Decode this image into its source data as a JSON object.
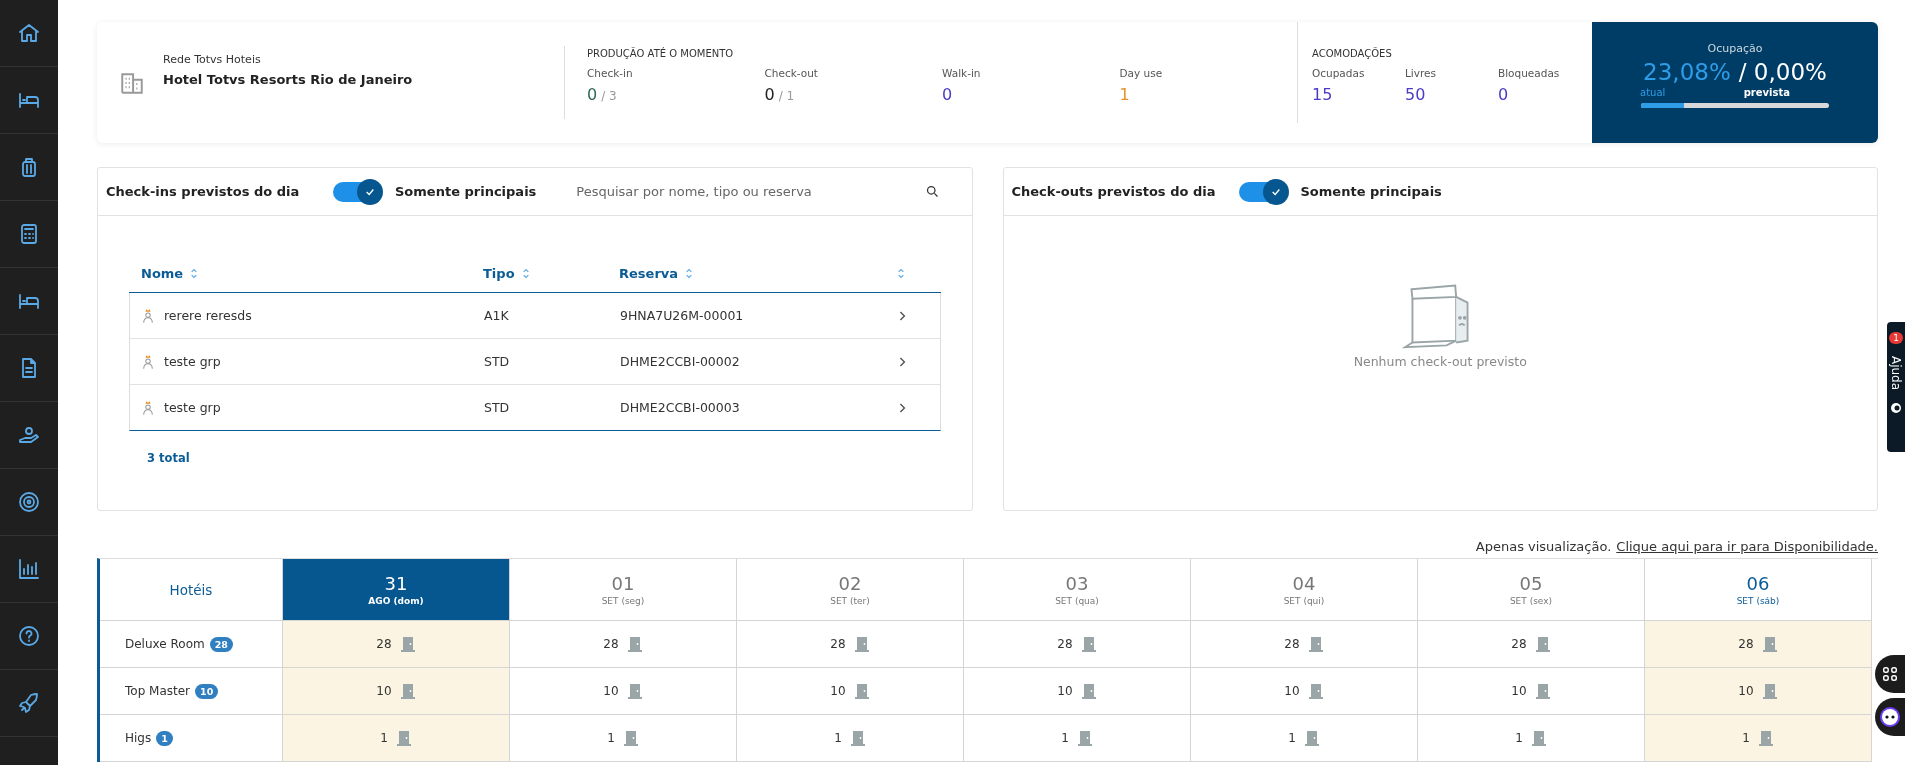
{
  "sidebar": {
    "items": [
      {
        "kind": "home"
      },
      {
        "kind": "bed"
      },
      {
        "kind": "luggage"
      },
      {
        "kind": "calculator"
      },
      {
        "kind": "bed"
      },
      {
        "kind": "document"
      },
      {
        "kind": "hand"
      },
      {
        "kind": "target"
      },
      {
        "kind": "chart"
      },
      {
        "kind": "help"
      },
      {
        "kind": "rocket"
      }
    ]
  },
  "header": {
    "network": "Rede Totvs Hoteis",
    "hotel": "Hotel Totvs Resorts Rio de Janeiro",
    "production": {
      "title": "PRODUÇÃO ATÉ O MOMENTO",
      "stats": [
        {
          "label": "Check-in",
          "value": "0",
          "total": "/ 3",
          "color": "#2d6a4f"
        },
        {
          "label": "Check-out",
          "value": "0",
          "total": "/ 1",
          "color": "#222222"
        },
        {
          "label": "Walk-in",
          "value": "0",
          "color": "#4b3cc4"
        },
        {
          "label": "Day use",
          "value": "1",
          "color": "#e8902a"
        }
      ]
    },
    "rooms": {
      "title": "ACOMODAÇÕES",
      "stats": [
        {
          "label": "Ocupadas",
          "value": "15",
          "color": "#4b3cc4"
        },
        {
          "label": "Livres",
          "value": "50",
          "color": "#4b3cc4"
        },
        {
          "label": "Bloqueadas",
          "value": "0",
          "color": "#4b3cc4"
        }
      ]
    },
    "occupancy": {
      "title": "Ocupação",
      "current": "23,08%",
      "forecast": "/ 0,00%",
      "current_label": "atual",
      "forecast_label": "prevista",
      "level": 0.23
    }
  },
  "checkins": {
    "title": "Check-ins previstos do dia",
    "toggle": {
      "on": true,
      "label": "Somente principais"
    },
    "search": {
      "placeholder": "Pesquisar por nome, tipo ou reserva"
    },
    "columns": [
      "Nome",
      "Tipo",
      "Reserva"
    ],
    "rows": [
      {
        "name": "rerere reresds",
        "type": "A1K",
        "reservation": "9HNA7U26M-00001"
      },
      {
        "name": "teste grp",
        "type": "STD",
        "reservation": "DHME2CCBI-00002"
      },
      {
        "name": "teste grp",
        "type": "STD",
        "reservation": "DHME2CCBI-00003"
      }
    ],
    "total": "3 total"
  },
  "checkouts": {
    "title": "Check-outs previstos do dia",
    "toggle": {
      "on": true,
      "label": "Somente principais"
    },
    "empty": "Nenhum check-out previsto"
  },
  "availability": {
    "note": "Apenas visualização.",
    "link": "Clique aqui para ir para Disponibilidade.",
    "hotels_label": "Hotéis",
    "days": [
      {
        "day": "31",
        "sub": "AGO (dom)",
        "kind": "today"
      },
      {
        "day": "01",
        "sub": "SET (seg)",
        "kind": "normal"
      },
      {
        "day": "02",
        "sub": "SET (ter)",
        "kind": "normal"
      },
      {
        "day": "03",
        "sub": "SET (qua)",
        "kind": "normal"
      },
      {
        "day": "04",
        "sub": "SET (qui)",
        "kind": "normal"
      },
      {
        "day": "05",
        "sub": "SET (sex)",
        "kind": "normal"
      },
      {
        "day": "06",
        "sub": "SET (sáb)",
        "kind": "weekend"
      }
    ],
    "rows": [
      {
        "name": "Deluxe Room",
        "count": "28",
        "cells": [
          "28",
          "28",
          "28",
          "28",
          "28",
          "28",
          "28"
        ]
      },
      {
        "name": "Top Master",
        "count": "10",
        "cells": [
          "10",
          "10",
          "10",
          "10",
          "10",
          "10",
          "10"
        ]
      },
      {
        "name": "Higs",
        "count": "1",
        "cells": [
          "1",
          "1",
          "1",
          "1",
          "1",
          "1",
          "1"
        ]
      }
    ]
  },
  "help": {
    "label": "Ajuda",
    "badge": "1"
  }
}
